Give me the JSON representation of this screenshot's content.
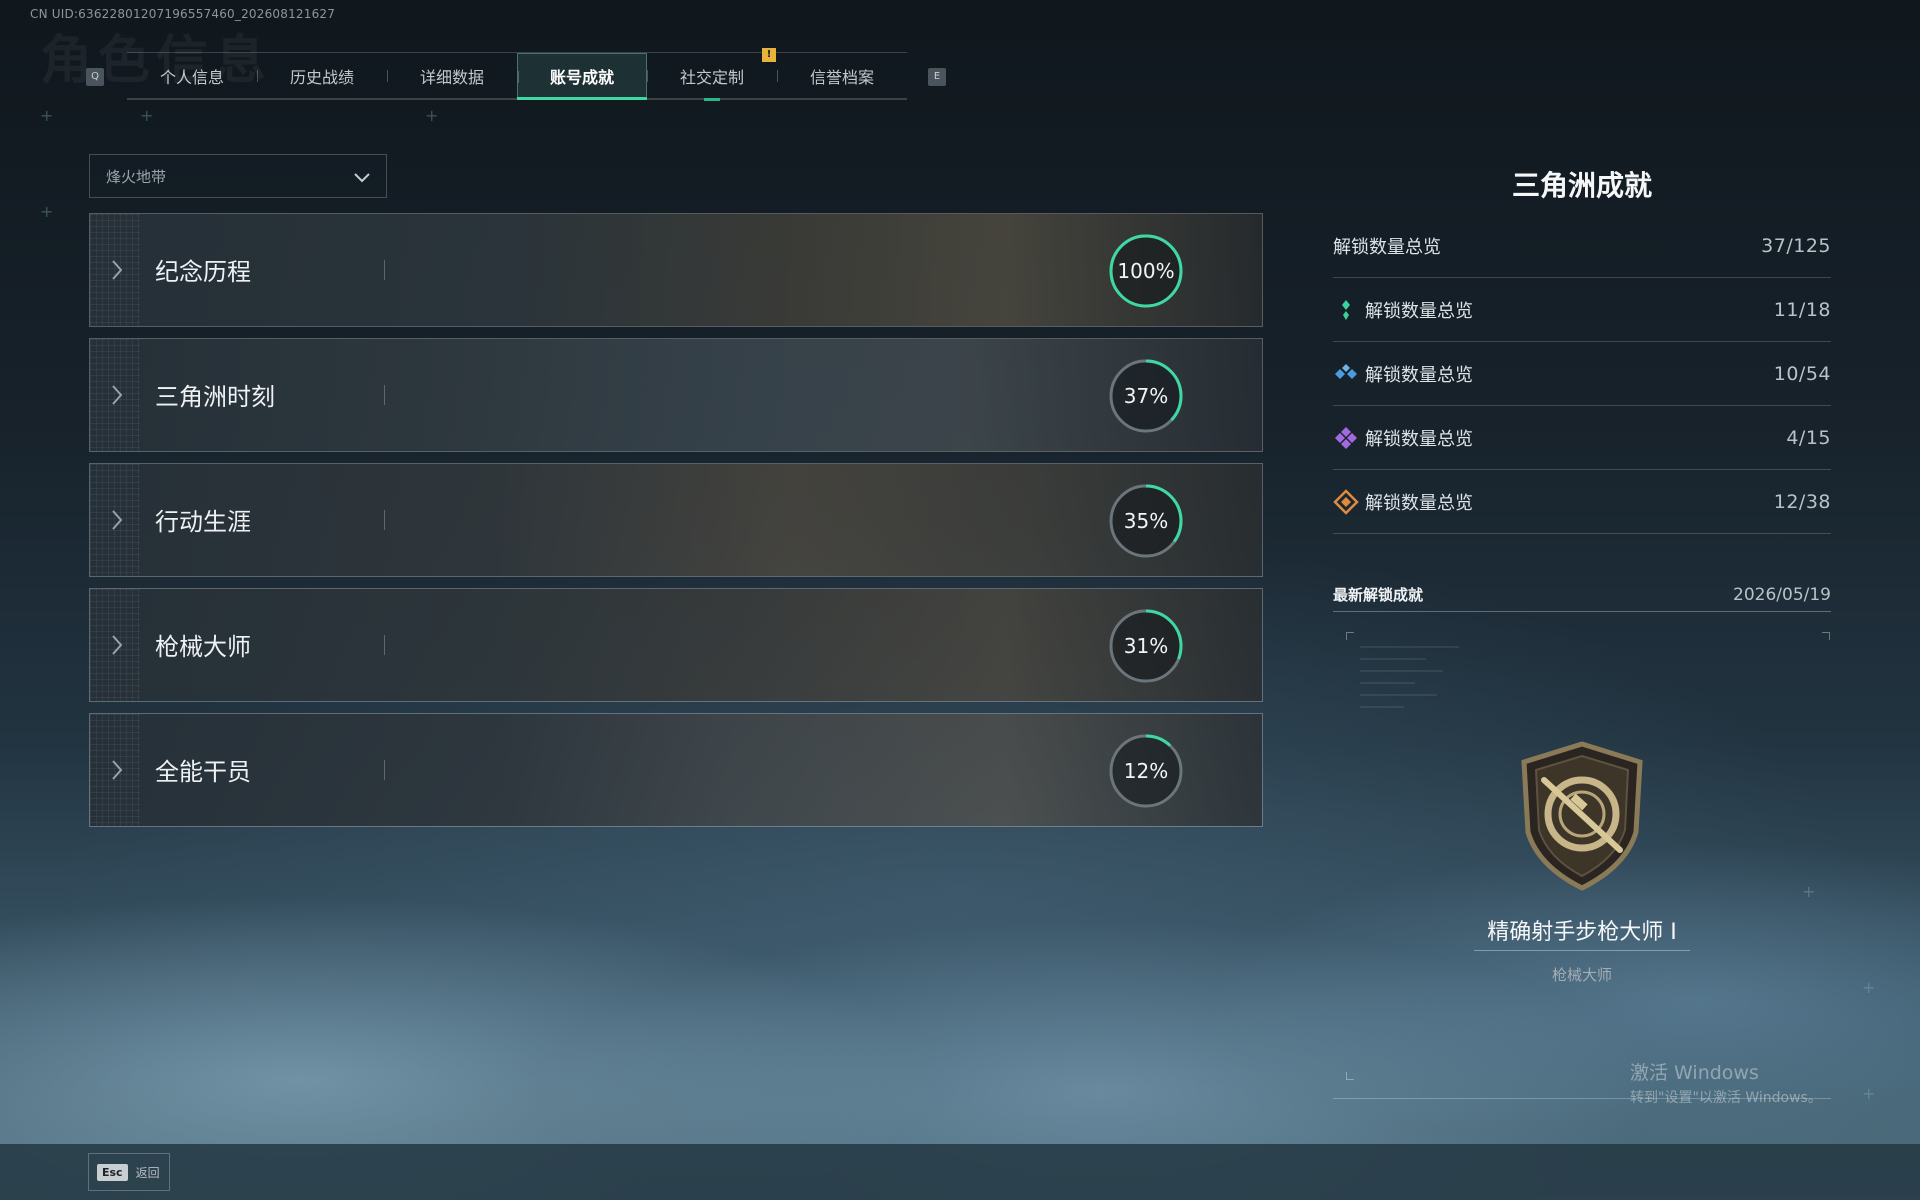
{
  "uid": "CN UID:636228012071965574​60_202608121627",
  "background_title": "角色信息",
  "tabs": {
    "prev_key": "Q",
    "next_key": "E",
    "items": [
      {
        "label": "个人信息"
      },
      {
        "label": "历史战绩"
      },
      {
        "label": "详细数据"
      },
      {
        "label": "账号成就"
      },
      {
        "label": "社交定制"
      },
      {
        "label": "信誉档案"
      }
    ],
    "active_index": 3,
    "badge": "!"
  },
  "mode_select": {
    "value": "烽火地带",
    "icon": "chevron-down-icon"
  },
  "categories": [
    {
      "name": "纪念历程",
      "code": "001",
      "progress": 100,
      "percent_label": "100%"
    },
    {
      "name": "三角洲时刻",
      "code": "002",
      "progress": 37,
      "percent_label": "37%"
    },
    {
      "name": "行动生涯",
      "code": "003",
      "progress": 35,
      "percent_label": "35%"
    },
    {
      "name": "枪械大师",
      "code": "004",
      "progress": 31,
      "percent_label": "31%"
    },
    {
      "name": "全能干员",
      "code": "005",
      "progress": 12,
      "percent_label": "12%"
    }
  ],
  "panel": {
    "title": "三角洲成就",
    "stats": [
      {
        "label": "解锁数量总览",
        "value": "37/125",
        "icon": "",
        "color": ""
      },
      {
        "label": "解锁数量总览",
        "value": "11/18",
        "icon": "green-tier-icon",
        "color": "#3fcf9a"
      },
      {
        "label": "解锁数量总览",
        "value": "10/54",
        "icon": "blue-tier-icon",
        "color": "#4a9be0"
      },
      {
        "label": "解锁数量总览",
        "value": "4/15",
        "icon": "purple-tier-icon",
        "color": "#a269e0"
      },
      {
        "label": "解锁数量总览",
        "value": "12/38",
        "icon": "orange-tier-icon",
        "color": "#e08a3e"
      }
    ],
    "latest": {
      "label": "最新解锁成就",
      "date": "2026/05/19",
      "achievement_name": "精确射手步枪大师 I",
      "achievement_category": "枪械大师",
      "icon": "rifle-shield-emblem-icon"
    }
  },
  "watermark": {
    "line1": "激活 Windows",
    "line2": "转到\"设置\"以激活 Windows。"
  },
  "footer": {
    "esc_key": "Esc",
    "back_label": "返回"
  },
  "colors": {
    "accent": "#3ed8a3",
    "ring_track": "#6b767c",
    "badge": "#e8b33a"
  }
}
